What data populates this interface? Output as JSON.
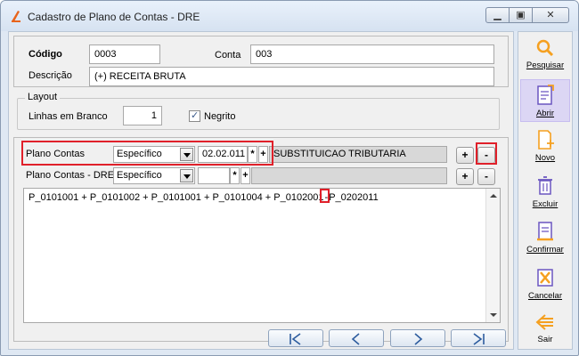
{
  "window": {
    "title": "Cadastro de Plano de Contas - DRE"
  },
  "header": {
    "codigo_label": "Código",
    "codigo_value": "0003",
    "conta_label": "Conta",
    "conta_value": "003",
    "descricao_label": "Descrição",
    "descricao_value": "(+) RECEITA BRUTA"
  },
  "layout": {
    "title": "Layout",
    "linhas_label": "Linhas em Branco",
    "linhas_value": "1",
    "negrito_label": "Negrito",
    "negrito_checked": true
  },
  "plano_contas": {
    "label": "Plano Contas",
    "tipo": "Específico",
    "codigo": "02.02.011",
    "descricao": "SUBSTITUICAO TRIBUTARIA"
  },
  "plano_contas_dre": {
    "label": "Plano Contas - DRE",
    "tipo": "Específico",
    "codigo": "",
    "descricao": ""
  },
  "formula": {
    "part1": "P_0101001 + P_0101002 + P_0101001 + P_0101004 + P_0102001",
    "op": "-",
    "part2": "P_0202011"
  },
  "buttons": {
    "asterisk": "*",
    "plus": "+",
    "minus": "-"
  },
  "sidebar": {
    "pesquisar": "Pesquisar",
    "abrir": "Abrir",
    "novo": "Novo",
    "excluir": "Excluir",
    "confirmar": "Confirmar",
    "cancelar": "Cancelar",
    "sair": "Sair"
  },
  "colors": {
    "highlight": "#e0202a",
    "accent": "#2d5c9e"
  }
}
